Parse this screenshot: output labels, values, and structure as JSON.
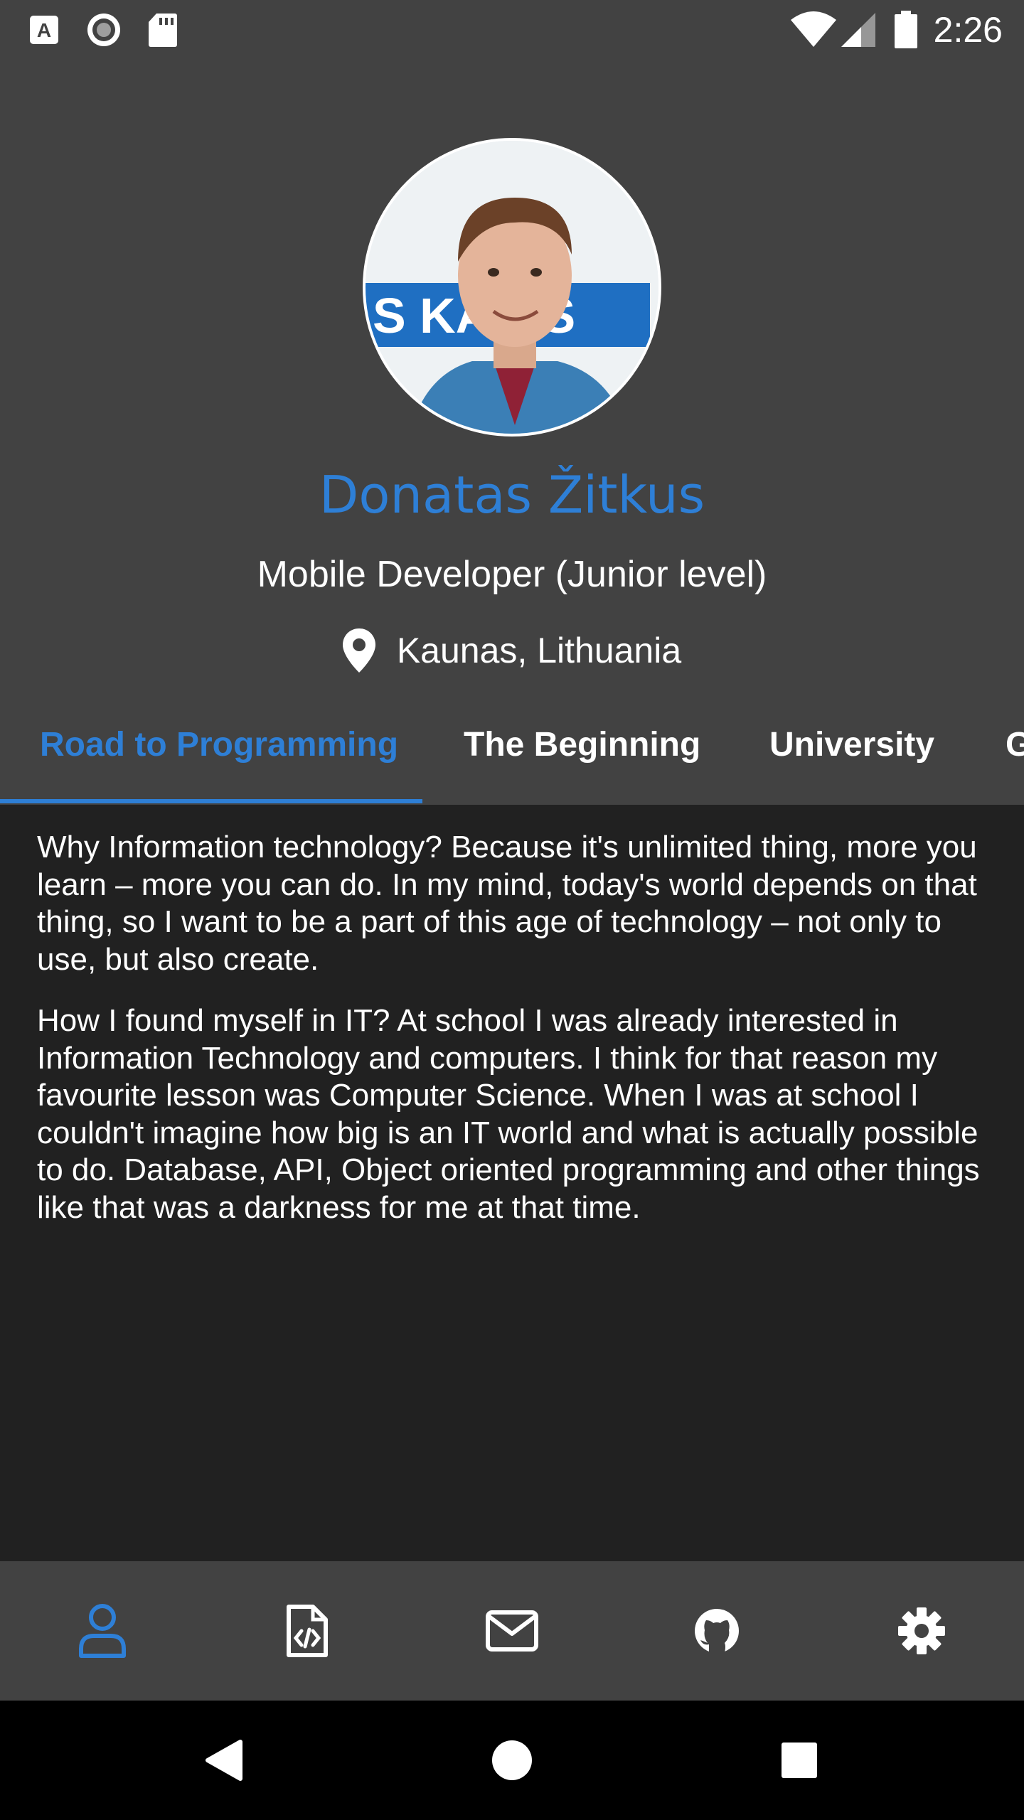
{
  "status_bar": {
    "time": "2:26",
    "icons_left": [
      "a-badge-icon",
      "record-icon",
      "sd-card-icon"
    ],
    "icons_right": [
      "wifi-icon",
      "cell-signal-icon",
      "battery-icon"
    ]
  },
  "profile": {
    "name": "Donatas Žitkus",
    "role": "Mobile Developer (Junior level)",
    "location": "Kaunas, Lithuania",
    "photo_banner_text": "S KA   OS"
  },
  "tabs": {
    "items": [
      {
        "label": "Road to Programming",
        "active": true
      },
      {
        "label": "The Beginning",
        "active": false
      },
      {
        "label": "University",
        "active": false
      },
      {
        "label": "G",
        "active": false
      }
    ]
  },
  "content": {
    "paragraphs": [
      "Why Information technology? Because it's unlimited thing, more you learn – more you can do. In my mind, today's world depends on that thing, so I want to be a part of this age of technology – not only to use, but also create.",
      "How I found myself in IT? At school I was already interested in Information Technology and computers. I think for that reason my favourite lesson was Computer Science. When I was at school I couldn't imagine how big is an IT world and what is actually possible to do. Database, API, Object oriented programming and other things like that was a darkness for me at that time."
    ]
  },
  "bottom_nav": {
    "items": [
      {
        "icon": "person-icon",
        "active": true
      },
      {
        "icon": "code-file-icon",
        "active": false
      },
      {
        "icon": "envelope-icon",
        "active": false
      },
      {
        "icon": "github-icon",
        "active": false
      },
      {
        "icon": "gear-icon",
        "active": false
      }
    ]
  },
  "colors": {
    "accent": "#2e7fd6",
    "header_bg": "#424242",
    "content_bg": "#212121",
    "text": "#ffffff"
  }
}
